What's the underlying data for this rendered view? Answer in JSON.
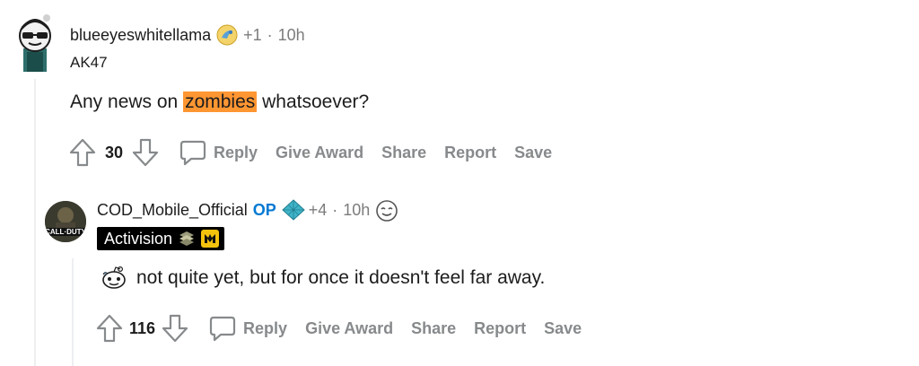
{
  "comment_1": {
    "username": "blueeyeswhitellama",
    "karma": "+1",
    "separator": "·",
    "timestamp": "10h",
    "flair": "AK47",
    "body_before": "Any news on ",
    "body_highlight": "zombies",
    "body_after": " whatsoever?",
    "vote_count": "30",
    "actions": {
      "reply": "Reply",
      "give_award": "Give Award",
      "share": "Share",
      "report": "Report",
      "save": "Save"
    }
  },
  "comment_2": {
    "username": "COD_Mobile_Official",
    "op_tag": "OP",
    "karma": "+4",
    "separator": "·",
    "timestamp": "10h",
    "flair": "Activision",
    "body": "not quite yet, but for once it doesn't feel far away.",
    "vote_count": "116",
    "actions": {
      "reply": "Reply",
      "give_award": "Give Award",
      "share": "Share",
      "report": "Report",
      "save": "Save"
    }
  },
  "colors": {
    "highlight": "#ff9632",
    "op": "#0079d3",
    "action_gray": "#878a8c",
    "meta_gray": "#7c7c7c"
  },
  "icons": [
    "avatar-llama",
    "avatar-cod",
    "award-icon",
    "diamond-award-icon",
    "smiley-award-icon",
    "upvote-icon",
    "downvote-icon",
    "comment-bubble-icon"
  ]
}
